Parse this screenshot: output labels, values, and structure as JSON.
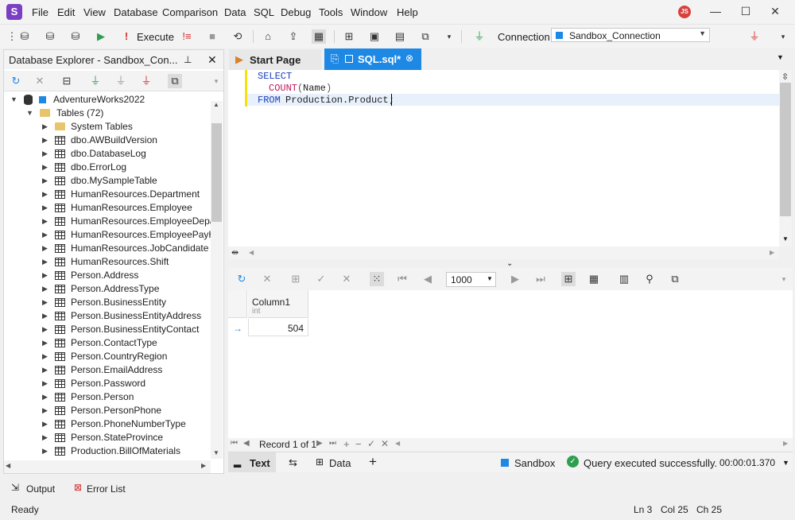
{
  "app": {
    "logo": "S",
    "user_initials": "JS"
  },
  "menu": [
    "File",
    "Edit",
    "View",
    "Database",
    "Comparison",
    "Data",
    "SQL",
    "Debug",
    "Tools",
    "Window",
    "Help"
  ],
  "toolbar": {
    "execute_label": "Execute",
    "connection_label": "Connection",
    "connection_value": "Sandbox_Connection"
  },
  "explorer": {
    "title": "Database Explorer - Sandbox_Con...",
    "database": "AdventureWorks2022",
    "tables_folder": "Tables (72)",
    "system_tables": "System Tables",
    "tables": [
      "dbo.AWBuildVersion",
      "dbo.DatabaseLog",
      "dbo.ErrorLog",
      "dbo.MySampleTable",
      "HumanResources.Department",
      "HumanResources.Employee",
      "HumanResources.EmployeeDepartme",
      "HumanResources.EmployeePayHisto",
      "HumanResources.JobCandidate",
      "HumanResources.Shift",
      "Person.Address",
      "Person.AddressType",
      "Person.BusinessEntity",
      "Person.BusinessEntityAddress",
      "Person.BusinessEntityContact",
      "Person.ContactType",
      "Person.CountryRegion",
      "Person.EmailAddress",
      "Person.Password",
      "Person.Person",
      "Person.PersonPhone",
      "Person.PhoneNumberType",
      "Person.StateProvince",
      "Production.BillOfMaterials"
    ]
  },
  "tabs": {
    "start": "Start Page",
    "sql": "SQL.sql*"
  },
  "editor": {
    "line1": "SELECT",
    "line2_fn": "COUNT",
    "line2_arg": "Name",
    "line3_kw": "FROM",
    "line3_obj": "Production.Product",
    "line3_end": ";"
  },
  "results": {
    "page_size": "1000",
    "column_name": "Column1",
    "column_type": "int",
    "value": "504",
    "record_label": "Record 1 of 1"
  },
  "status": {
    "text_tab": "Text",
    "data_tab": "Data",
    "connection": "Sandbox",
    "message": "Query executed successfully.",
    "elapsed": "00:00:01.370"
  },
  "bottom": {
    "output": "Output",
    "errors": "Error List"
  },
  "statusbar": {
    "ready": "Ready",
    "ln": "Ln 3",
    "col": "Col 25",
    "ch": "Ch 25"
  },
  "colors": {
    "accent": "#1e88e5",
    "success": "#2e9e4f",
    "brand": "#7b3fc4"
  }
}
